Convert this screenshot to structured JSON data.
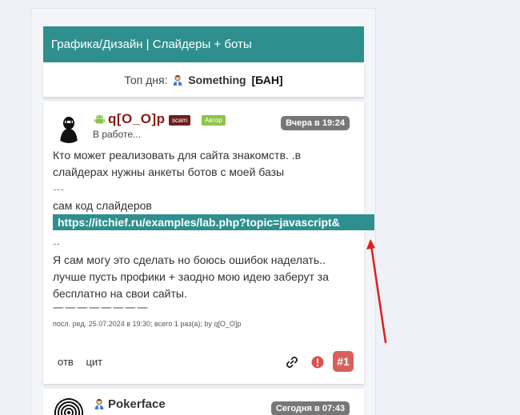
{
  "topic": {
    "title": "Графика/Дизайн | Слайдеры + боты"
  },
  "top_of_day": {
    "label": "Топ дня:",
    "user": "Something",
    "tag": "[БАН]"
  },
  "post": {
    "author": "q[O_O]p",
    "badge_scam": "scam",
    "badge_author": "Автор",
    "status": "В работе...",
    "date_prefix": "Вчера в ",
    "date_time": "19:24",
    "lines": [
      "Кто может реализовать для сайта знакомств. .в",
      "слайдерах нужны анкеты ботов с моей базы",
      "---",
      "сам код слайдеров"
    ],
    "link": "https://itchief.ru/examples/lab.php?topic=javascript&",
    "after_link_sep": "--",
    "lines2": [
      "Я сам могу это сделать но боюсь ошибок наделать..",
      "лучше пусть профики + заодно мою идею заберут за",
      "бесплатно на свои сайты."
    ],
    "signature": "————————",
    "meta": "посл. ред. 25.07.2024 в 19:30; всего 1 раз(а); by q[O_O]p",
    "actions": {
      "reply": "отв",
      "quote": "цит"
    },
    "number": "#1"
  },
  "post2": {
    "author": "Pokerface",
    "date_prefix": "Сегодня в ",
    "date_time": "07:43"
  },
  "colors": {
    "accent": "#2f8f8f",
    "author_red": "#8b1c14",
    "badge_red": "#d9605a",
    "arrow": "#e01e1e"
  },
  "icons": [
    "user-icon",
    "android-icon",
    "link-icon",
    "warning-icon",
    "arrow-annotation"
  ]
}
